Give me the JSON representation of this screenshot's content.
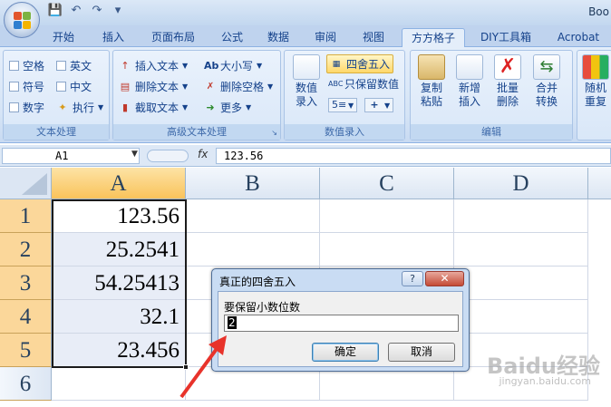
{
  "window": {
    "title_fragment": "Boo"
  },
  "qat": {
    "save_icon": "save-icon",
    "undo_icon": "undo-icon",
    "redo_icon": "redo-icon"
  },
  "tabs": [
    {
      "label": "开始"
    },
    {
      "label": "插入"
    },
    {
      "label": "页面布局"
    },
    {
      "label": "公式"
    },
    {
      "label": "数据"
    },
    {
      "label": "审阅"
    },
    {
      "label": "视图"
    },
    {
      "label": "方方格子"
    },
    {
      "label": "DIY工具箱"
    },
    {
      "label": "Acrobat"
    }
  ],
  "active_tab": "方方格子",
  "ribbon": {
    "text_group": {
      "title": "文本处理",
      "checks": [
        "空格",
        "英文",
        "符号",
        "中文",
        "数字"
      ],
      "execute": "执行"
    },
    "adv_group": {
      "title": "高级文本处理",
      "items": [
        "插入文本",
        "大小写",
        "删除文本",
        "删除空格",
        "截取文本",
        "更多"
      ]
    },
    "num_group": {
      "title": "数值录入",
      "value_entry": "数值",
      "value_entry2": "录入",
      "round": "四舍五入",
      "keep_values": "只保留数值"
    },
    "edit_group": {
      "title": "编辑",
      "copy_paste": [
        "复制",
        "粘贴"
      ],
      "new_insert": [
        "新增",
        "插入"
      ],
      "batch_delete": [
        "批量",
        "删除"
      ],
      "merge_convert": [
        "合并",
        "转换"
      ],
      "random_repeat": [
        "随机",
        "重复"
      ]
    }
  },
  "formula_bar": {
    "name_box": "A1",
    "fx": "fx",
    "formula": "123.56"
  },
  "sheet": {
    "columns": [
      "A",
      "B",
      "C",
      "D"
    ],
    "rows": [
      "1",
      "2",
      "3",
      "4",
      "5",
      "6"
    ],
    "cells": [
      "123.56",
      "25.2541",
      "54.25413",
      "32.1",
      "23.456"
    ]
  },
  "dialog": {
    "title": "真正的四舍五入",
    "help": "?",
    "close": "✕",
    "prompt": "要保留小数位数",
    "value": "2",
    "ok": "确定",
    "cancel": "取消"
  },
  "watermark": {
    "brand": "Baidu经验",
    "url": "jingyan.baidu.com"
  },
  "colors": {
    "accent": "#15428b",
    "row_header_selected": "#fbd79a",
    "arrow": "#e8332b"
  }
}
